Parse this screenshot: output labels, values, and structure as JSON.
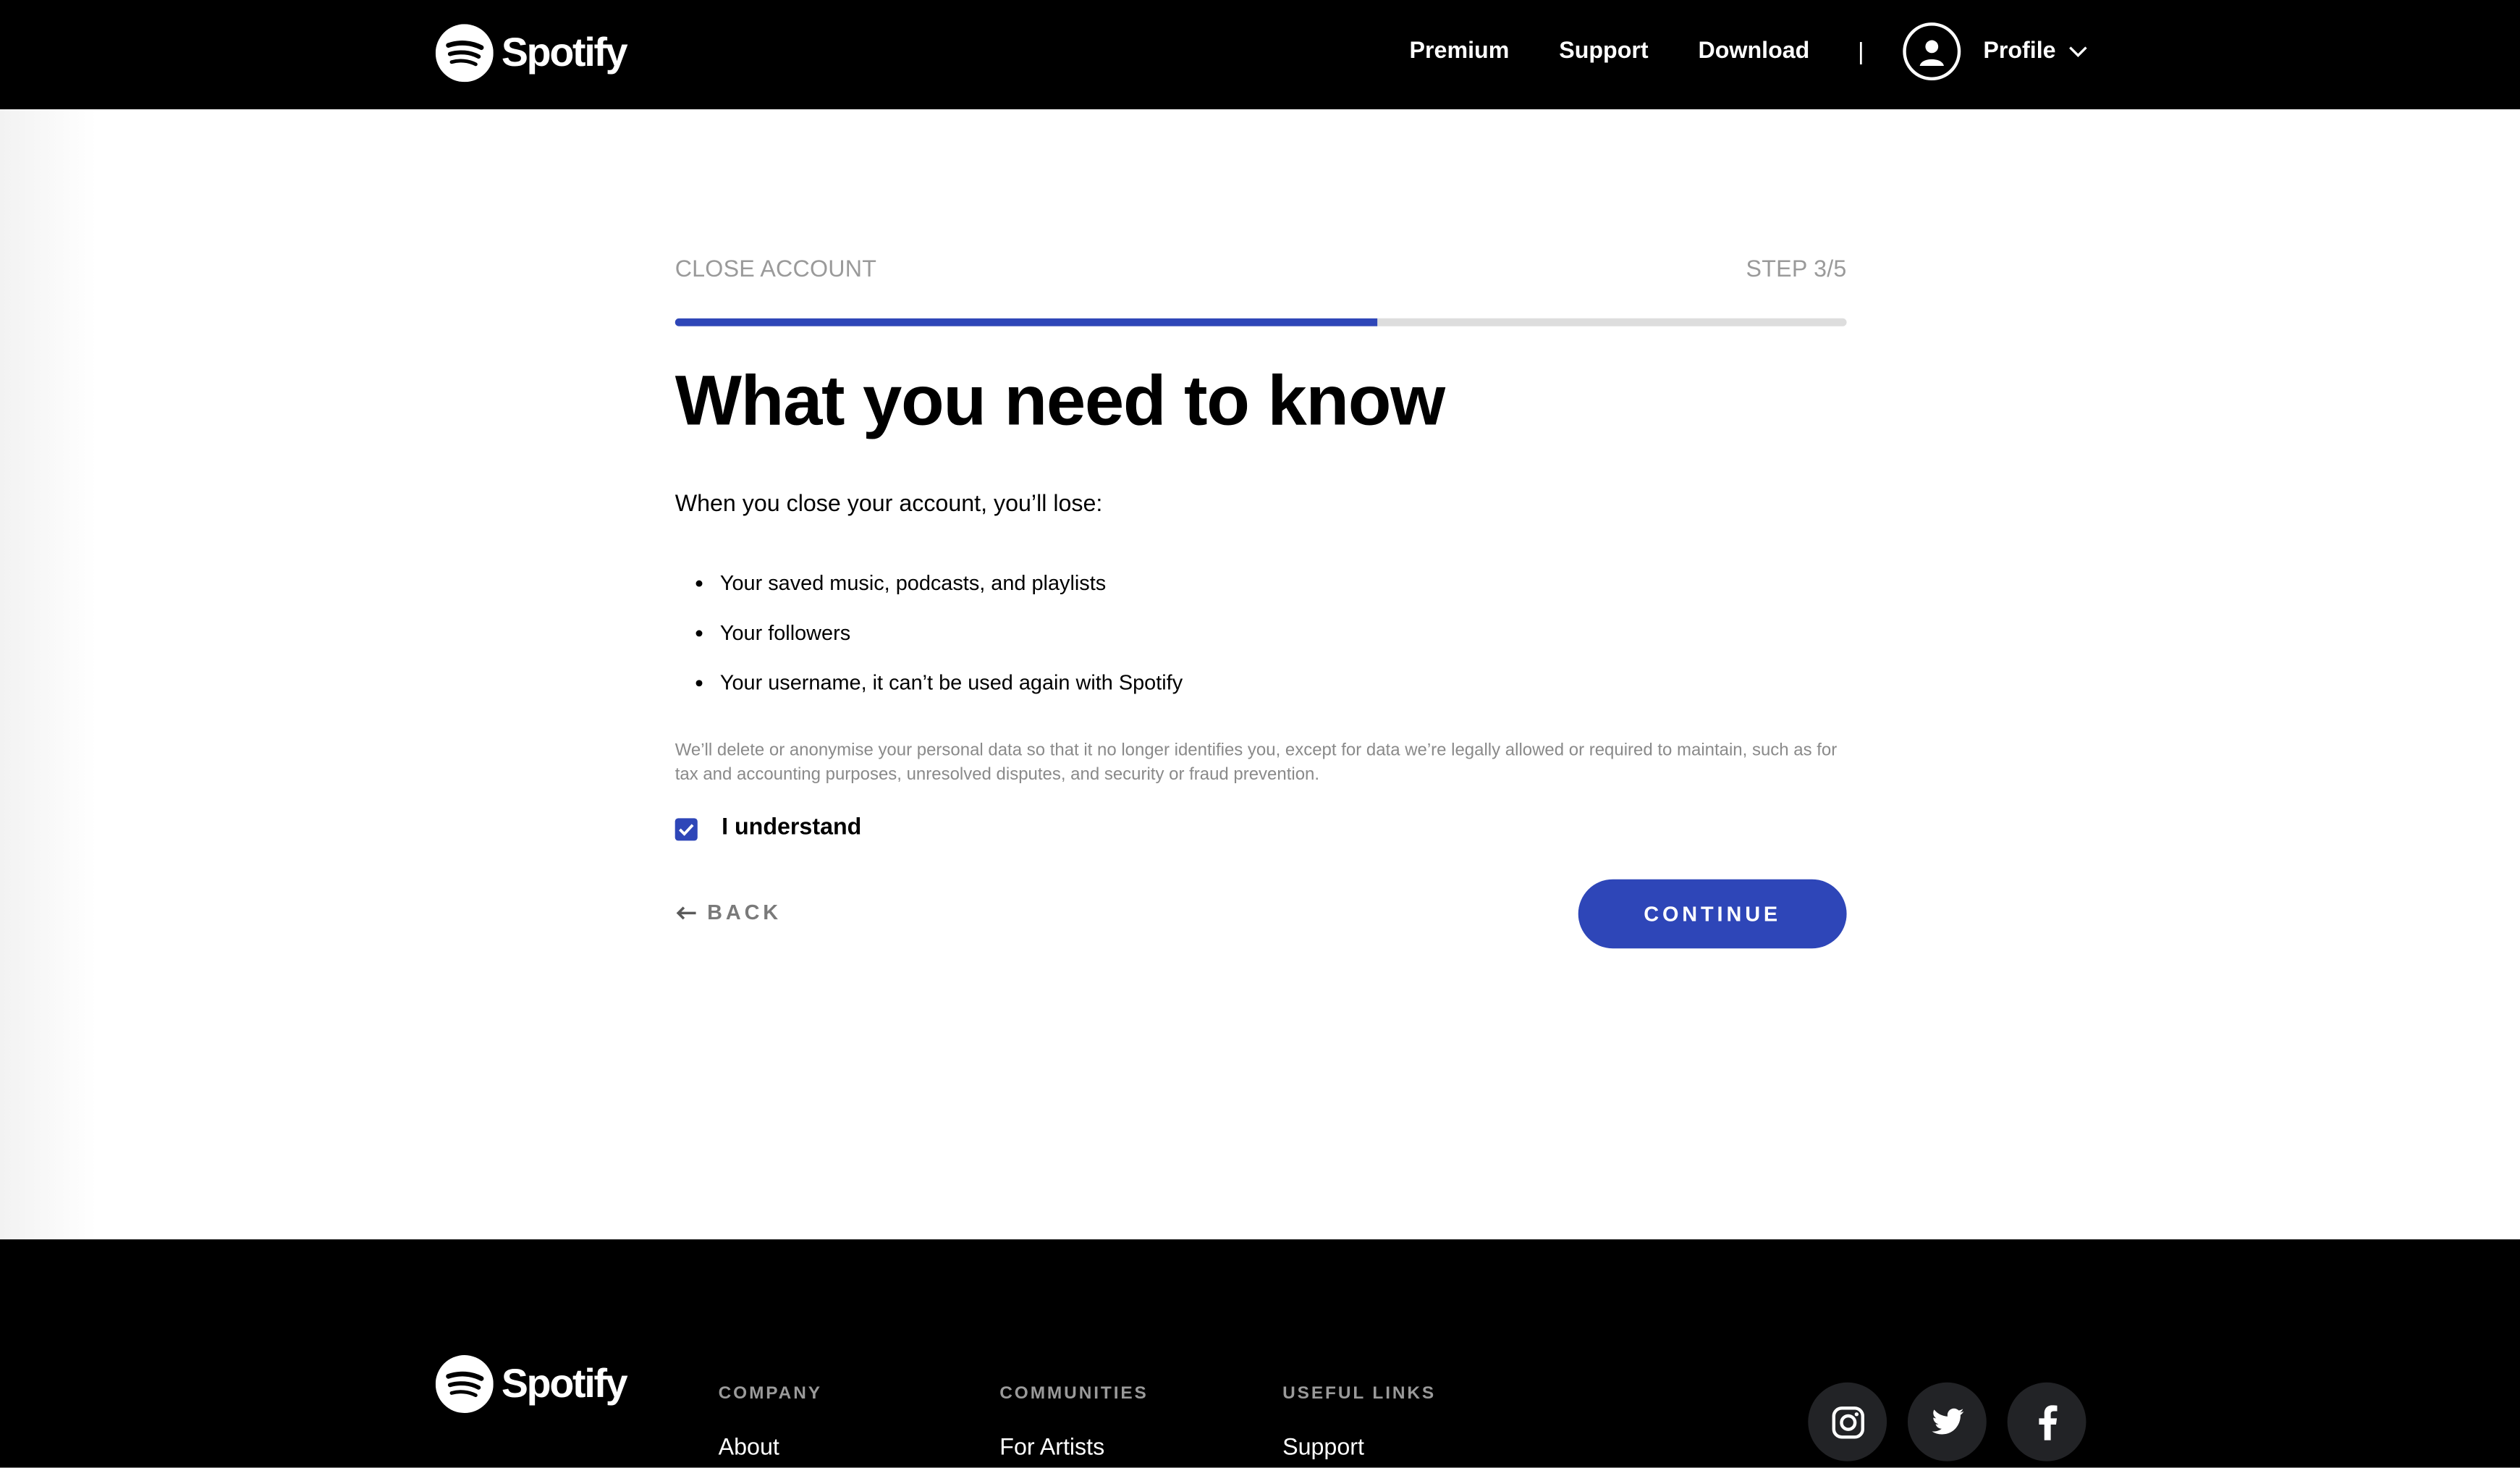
{
  "header": {
    "brand": "Spotify",
    "nav": {
      "premium": "Premium",
      "support": "Support",
      "download": "Download",
      "separator": "|"
    },
    "profile": {
      "label": "Profile",
      "icon": "user-icon",
      "menu_icon": "chevron-down-icon"
    }
  },
  "main": {
    "section_label": "CLOSE ACCOUNT",
    "step_label": "STEP 3/5",
    "progress_fraction": 0.6,
    "title": "What you need to know",
    "intro": "When you close your account, you’ll lose:",
    "losses": [
      "Your saved music, podcasts, and playlists",
      "Your followers",
      "Your username, it can’t be used again with Spotify"
    ],
    "legal": "We’ll delete or anonymise your personal data so that it no longer identifies you, except for data we’re legally allowed or required to maintain, such as for tax and accounting purposes, unresolved disputes, and security or fraud prevention.",
    "understand_label": "I understand",
    "understand_checked": true,
    "back_label": "BACK",
    "back_icon": "arrow-left-icon",
    "continue_label": "CONTINUE"
  },
  "footer": {
    "brand": "Spotify",
    "columns": [
      {
        "heading": "COMPANY",
        "first_link": "About"
      },
      {
        "heading": "COMMUNITIES",
        "first_link": "For Artists"
      },
      {
        "heading": "USEFUL LINKS",
        "first_link": "Support"
      }
    ],
    "social": [
      "instagram-icon",
      "twitter-icon",
      "facebook-icon"
    ]
  },
  "colors": {
    "accent": "#2e46b8",
    "header_bg": "#000000",
    "muted_text": "#9a9a9a",
    "progress_track": "#dddddd"
  }
}
